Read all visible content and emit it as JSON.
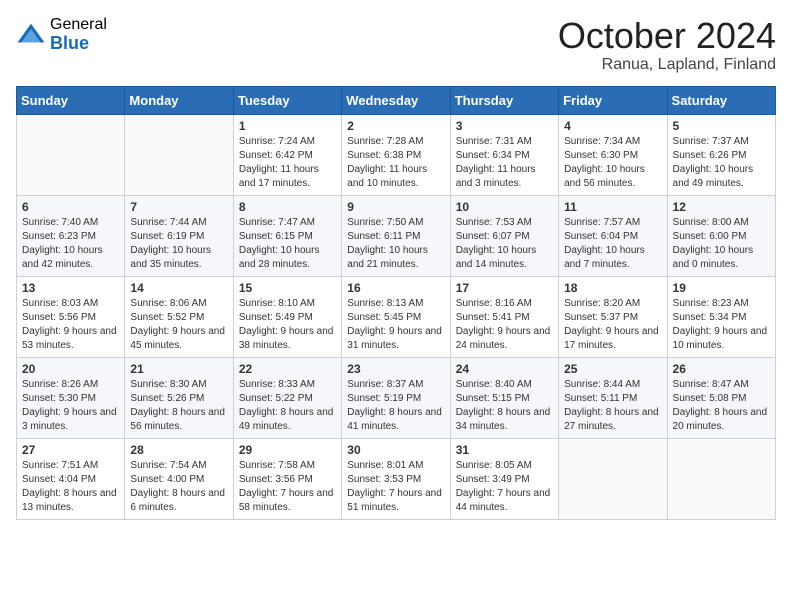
{
  "logo": {
    "general": "General",
    "blue": "Blue"
  },
  "title": "October 2024",
  "location": "Ranua, Lapland, Finland",
  "weekdays": [
    "Sunday",
    "Monday",
    "Tuesday",
    "Wednesday",
    "Thursday",
    "Friday",
    "Saturday"
  ],
  "weeks": [
    [
      null,
      null,
      {
        "day": "1",
        "sunrise": "Sunrise: 7:24 AM",
        "sunset": "Sunset: 6:42 PM",
        "daylight": "Daylight: 11 hours and 17 minutes."
      },
      {
        "day": "2",
        "sunrise": "Sunrise: 7:28 AM",
        "sunset": "Sunset: 6:38 PM",
        "daylight": "Daylight: 11 hours and 10 minutes."
      },
      {
        "day": "3",
        "sunrise": "Sunrise: 7:31 AM",
        "sunset": "Sunset: 6:34 PM",
        "daylight": "Daylight: 11 hours and 3 minutes."
      },
      {
        "day": "4",
        "sunrise": "Sunrise: 7:34 AM",
        "sunset": "Sunset: 6:30 PM",
        "daylight": "Daylight: 10 hours and 56 minutes."
      },
      {
        "day": "5",
        "sunrise": "Sunrise: 7:37 AM",
        "sunset": "Sunset: 6:26 PM",
        "daylight": "Daylight: 10 hours and 49 minutes."
      }
    ],
    [
      {
        "day": "6",
        "sunrise": "Sunrise: 7:40 AM",
        "sunset": "Sunset: 6:23 PM",
        "daylight": "Daylight: 10 hours and 42 minutes."
      },
      {
        "day": "7",
        "sunrise": "Sunrise: 7:44 AM",
        "sunset": "Sunset: 6:19 PM",
        "daylight": "Daylight: 10 hours and 35 minutes."
      },
      {
        "day": "8",
        "sunrise": "Sunrise: 7:47 AM",
        "sunset": "Sunset: 6:15 PM",
        "daylight": "Daylight: 10 hours and 28 minutes."
      },
      {
        "day": "9",
        "sunrise": "Sunrise: 7:50 AM",
        "sunset": "Sunset: 6:11 PM",
        "daylight": "Daylight: 10 hours and 21 minutes."
      },
      {
        "day": "10",
        "sunrise": "Sunrise: 7:53 AM",
        "sunset": "Sunset: 6:07 PM",
        "daylight": "Daylight: 10 hours and 14 minutes."
      },
      {
        "day": "11",
        "sunrise": "Sunrise: 7:57 AM",
        "sunset": "Sunset: 6:04 PM",
        "daylight": "Daylight: 10 hours and 7 minutes."
      },
      {
        "day": "12",
        "sunrise": "Sunrise: 8:00 AM",
        "sunset": "Sunset: 6:00 PM",
        "daylight": "Daylight: 10 hours and 0 minutes."
      }
    ],
    [
      {
        "day": "13",
        "sunrise": "Sunrise: 8:03 AM",
        "sunset": "Sunset: 5:56 PM",
        "daylight": "Daylight: 9 hours and 53 minutes."
      },
      {
        "day": "14",
        "sunrise": "Sunrise: 8:06 AM",
        "sunset": "Sunset: 5:52 PM",
        "daylight": "Daylight: 9 hours and 45 minutes."
      },
      {
        "day": "15",
        "sunrise": "Sunrise: 8:10 AM",
        "sunset": "Sunset: 5:49 PM",
        "daylight": "Daylight: 9 hours and 38 minutes."
      },
      {
        "day": "16",
        "sunrise": "Sunrise: 8:13 AM",
        "sunset": "Sunset: 5:45 PM",
        "daylight": "Daylight: 9 hours and 31 minutes."
      },
      {
        "day": "17",
        "sunrise": "Sunrise: 8:16 AM",
        "sunset": "Sunset: 5:41 PM",
        "daylight": "Daylight: 9 hours and 24 minutes."
      },
      {
        "day": "18",
        "sunrise": "Sunrise: 8:20 AM",
        "sunset": "Sunset: 5:37 PM",
        "daylight": "Daylight: 9 hours and 17 minutes."
      },
      {
        "day": "19",
        "sunrise": "Sunrise: 8:23 AM",
        "sunset": "Sunset: 5:34 PM",
        "daylight": "Daylight: 9 hours and 10 minutes."
      }
    ],
    [
      {
        "day": "20",
        "sunrise": "Sunrise: 8:26 AM",
        "sunset": "Sunset: 5:30 PM",
        "daylight": "Daylight: 9 hours and 3 minutes."
      },
      {
        "day": "21",
        "sunrise": "Sunrise: 8:30 AM",
        "sunset": "Sunset: 5:26 PM",
        "daylight": "Daylight: 8 hours and 56 minutes."
      },
      {
        "day": "22",
        "sunrise": "Sunrise: 8:33 AM",
        "sunset": "Sunset: 5:22 PM",
        "daylight": "Daylight: 8 hours and 49 minutes."
      },
      {
        "day": "23",
        "sunrise": "Sunrise: 8:37 AM",
        "sunset": "Sunset: 5:19 PM",
        "daylight": "Daylight: 8 hours and 41 minutes."
      },
      {
        "day": "24",
        "sunrise": "Sunrise: 8:40 AM",
        "sunset": "Sunset: 5:15 PM",
        "daylight": "Daylight: 8 hours and 34 minutes."
      },
      {
        "day": "25",
        "sunrise": "Sunrise: 8:44 AM",
        "sunset": "Sunset: 5:11 PM",
        "daylight": "Daylight: 8 hours and 27 minutes."
      },
      {
        "day": "26",
        "sunrise": "Sunrise: 8:47 AM",
        "sunset": "Sunset: 5:08 PM",
        "daylight": "Daylight: 8 hours and 20 minutes."
      }
    ],
    [
      {
        "day": "27",
        "sunrise": "Sunrise: 7:51 AM",
        "sunset": "Sunset: 4:04 PM",
        "daylight": "Daylight: 8 hours and 13 minutes."
      },
      {
        "day": "28",
        "sunrise": "Sunrise: 7:54 AM",
        "sunset": "Sunset: 4:00 PM",
        "daylight": "Daylight: 8 hours and 6 minutes."
      },
      {
        "day": "29",
        "sunrise": "Sunrise: 7:58 AM",
        "sunset": "Sunset: 3:56 PM",
        "daylight": "Daylight: 7 hours and 58 minutes."
      },
      {
        "day": "30",
        "sunrise": "Sunrise: 8:01 AM",
        "sunset": "Sunset: 3:53 PM",
        "daylight": "Daylight: 7 hours and 51 minutes."
      },
      {
        "day": "31",
        "sunrise": "Sunrise: 8:05 AM",
        "sunset": "Sunset: 3:49 PM",
        "daylight": "Daylight: 7 hours and 44 minutes."
      },
      null,
      null
    ]
  ]
}
